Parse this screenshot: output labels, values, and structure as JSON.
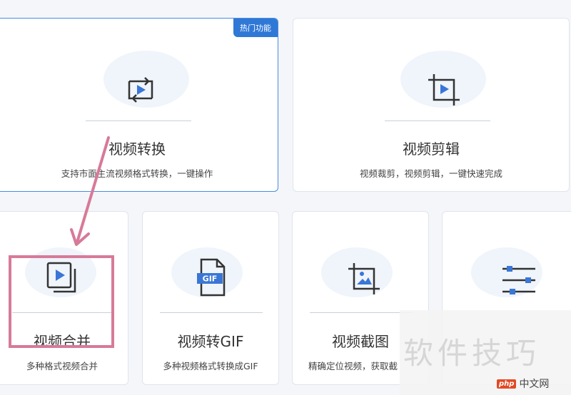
{
  "cards": [
    {
      "title": "视频转换",
      "desc": "支持市面主流视频格式转换，一键操作",
      "icon": "video-convert-icon",
      "badge": "热门功能"
    },
    {
      "title": "视频剪辑",
      "desc": "视频裁剪，视频剪辑，一键快速完成",
      "icon": "video-crop-icon"
    },
    {
      "title": "视频合并",
      "desc": "多种格式视频合并",
      "icon": "video-merge-icon"
    },
    {
      "title": "视频转GIF",
      "desc": "多种视频格式转换成GIF",
      "icon": "gif-file-icon",
      "icon_label": "GIF"
    },
    {
      "title": "视频截图",
      "desc": "精确定位视频，获取截",
      "icon": "video-screenshot-icon"
    },
    {
      "title": "",
      "desc": "",
      "icon": "sliders-icon"
    }
  ],
  "colors": {
    "accent": "#2f78d6",
    "highlight": "#d77a98",
    "icon_dark": "#333333",
    "icon_blue": "#3a76d6"
  },
  "watermark": {
    "text": "软件技巧",
    "logo_mark": "php",
    "logo_text": "中文网"
  }
}
